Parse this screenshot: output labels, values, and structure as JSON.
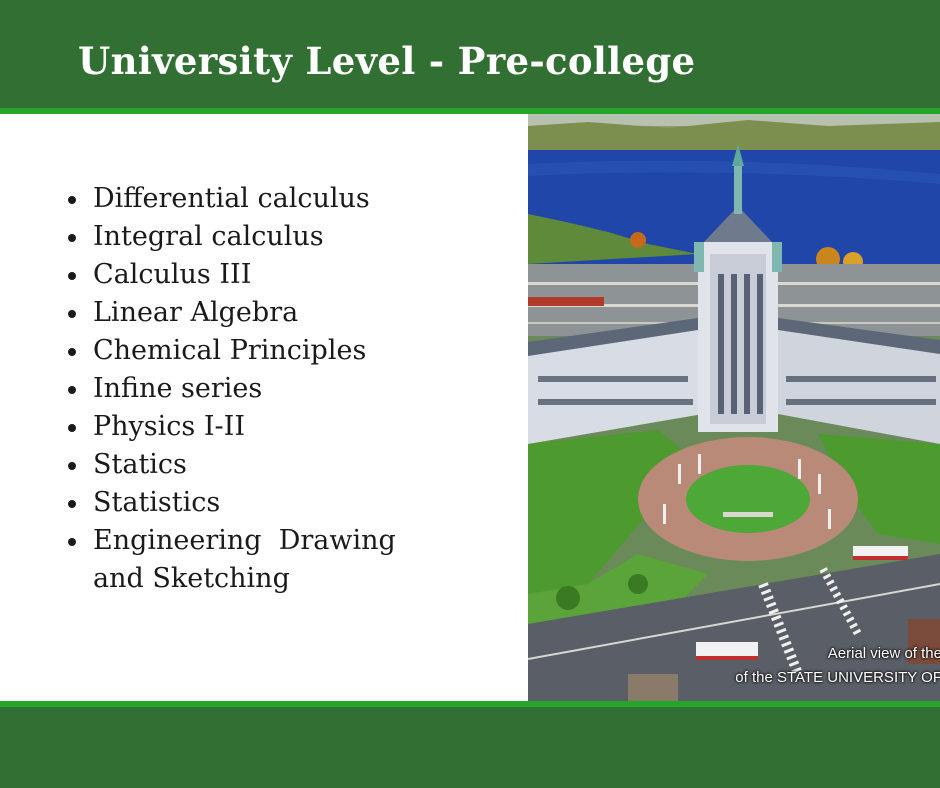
{
  "slide": {
    "title": "University Level - Pre-college",
    "bullets": [
      "Differential calculus",
      "Integral calculus",
      "Calculus III",
      "Linear Algebra",
      "Chemical Principles",
      "Infine series",
      "Physics I-II",
      "Statics",
      "Statistics",
      "Engineering  Drawing and Sketching"
    ]
  },
  "photo": {
    "caption_line1": "Aerial view of the",
    "caption_line2": "of the STATE UNIVERSITY OF"
  },
  "colors": {
    "header_green": "#326f33",
    "accent_green": "#25a52a",
    "text": "#1a1a1a"
  }
}
